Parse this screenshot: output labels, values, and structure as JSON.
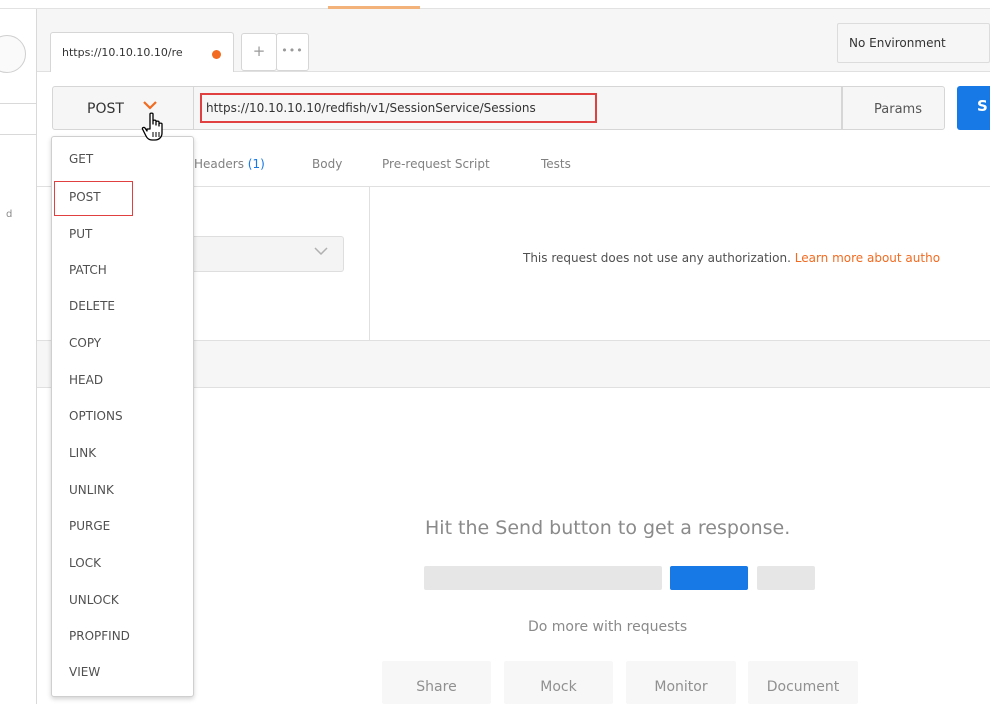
{
  "tabs": {
    "active_tab_label": "https://10.10.10.10/re",
    "add_symbol": "+",
    "more_symbol": "•••"
  },
  "environment": {
    "label": "No Environment"
  },
  "request": {
    "method": "POST",
    "url": "https://10.10.10.10/redfish/v1/SessionService/Sessions",
    "params_label": "Params",
    "send_label": "S"
  },
  "request_tabs": [
    {
      "label": "Headers",
      "count": "(1)"
    },
    {
      "label": "Body"
    },
    {
      "label": "Pre-request Script"
    },
    {
      "label": "Tests"
    }
  ],
  "auth": {
    "message": "This request does not use any authorization.",
    "link_text": "Learn more about autho"
  },
  "method_menu": {
    "items": [
      "GET",
      "POST",
      "PUT",
      "PATCH",
      "DELETE",
      "COPY",
      "HEAD",
      "OPTIONS",
      "LINK",
      "UNLINK",
      "PURGE",
      "LOCK",
      "UNLOCK",
      "PROPFIND",
      "VIEW"
    ],
    "highlighted": "POST"
  },
  "response": {
    "empty_message": "Hit the Send button to get a response.",
    "more_text": "Do more with requests",
    "actions": [
      "Share",
      "Mock",
      "Monitor",
      "Document"
    ]
  },
  "colors": {
    "accent_orange": "#f26b21",
    "send_blue": "#1679e6",
    "highlight_red": "#e04040"
  },
  "icons": {
    "method_caret": "chevron-down-icon",
    "cursor": "hand-pointer-icon",
    "auth_select": "chevron-down-icon"
  }
}
